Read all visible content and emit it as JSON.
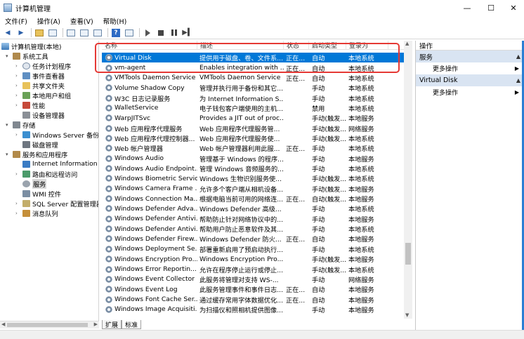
{
  "window": {
    "title": "计算机管理",
    "controls": {
      "minimize": "—",
      "maximize": "☐",
      "close": "✕"
    }
  },
  "menu": [
    "文件(F)",
    "操作(A)",
    "查看(V)",
    "帮助(H)"
  ],
  "tree": {
    "items": [
      {
        "label": "计算机管理(本地)",
        "icon": "computer-icon",
        "expander": "",
        "level": 0
      },
      {
        "label": "系统工具",
        "icon": "tools-icon",
        "expander": "▾",
        "level": 1
      },
      {
        "label": "任务计划程序",
        "icon": "task-scheduler-icon",
        "expander": "›",
        "level": 2
      },
      {
        "label": "事件查看器",
        "icon": "event-viewer-icon",
        "expander": "›",
        "level": 2
      },
      {
        "label": "共享文件夹",
        "icon": "shared-folder-icon",
        "expander": "›",
        "level": 2
      },
      {
        "label": "本地用户和组",
        "icon": "users-icon",
        "expander": "›",
        "level": 2
      },
      {
        "label": "性能",
        "icon": "performance-icon",
        "expander": "›",
        "level": 2
      },
      {
        "label": "设备管理器",
        "icon": "device-manager-icon",
        "expander": "",
        "level": 2
      },
      {
        "label": "存储",
        "icon": "storage-icon",
        "expander": "▾",
        "level": 1
      },
      {
        "label": "Windows Server 备份",
        "icon": "backup-icon",
        "expander": "›",
        "level": 2
      },
      {
        "label": "磁盘管理",
        "icon": "disk-icon",
        "expander": "",
        "level": 2
      },
      {
        "label": "服务和应用程序",
        "icon": "services-apps-icon",
        "expander": "▾",
        "level": 1
      },
      {
        "label": "Internet Information S",
        "icon": "iis-icon",
        "expander": "",
        "level": 2
      },
      {
        "label": "路由和远程访问",
        "icon": "routing-icon",
        "expander": "›",
        "level": 2
      },
      {
        "label": "服务",
        "icon": "services-gear-icon",
        "expander": "",
        "level": 2,
        "selected": true
      },
      {
        "label": "WMI 控件",
        "icon": "wmi-icon",
        "expander": "",
        "level": 2
      },
      {
        "label": "SQL Server 配置管理器",
        "icon": "sql-icon",
        "expander": "›",
        "level": 2
      },
      {
        "label": "消息队列",
        "icon": "message-queue-icon",
        "expander": "›",
        "level": 2
      }
    ]
  },
  "list": {
    "headers": [
      "名称",
      "描述",
      "状态",
      "启动类型",
      "登录为"
    ],
    "rows": [
      {
        "name": "Virtual Disk",
        "desc": "提供用于磁盘、卷、文件系...",
        "status": "正在...",
        "start": "自动",
        "logon": "本地系统",
        "selected": true
      },
      {
        "name": "vm-agent",
        "desc": "Enables integration with ...",
        "status": "正在...",
        "start": "自动",
        "logon": "本地系统"
      },
      {
        "name": "VMTools Daemon Service",
        "desc": "VMTools Daemon Service",
        "status": "正在...",
        "start": "自动",
        "logon": "本地系统"
      },
      {
        "name": "Volume Shadow Copy",
        "desc": "管理并执行用于备份和其它...",
        "status": "",
        "start": "手动",
        "logon": "本地系统"
      },
      {
        "name": "W3C 日志记录服务",
        "desc": "为 Internet Information S...",
        "status": "",
        "start": "手动",
        "logon": "本地系统"
      },
      {
        "name": "WalletService",
        "desc": "电子钱包客户端使用的主机...",
        "status": "",
        "start": "禁用",
        "logon": "本地系统"
      },
      {
        "name": "WarpJITSvc",
        "desc": "Provides a JIT out of proc...",
        "status": "",
        "start": "手动(触发...",
        "logon": "本地服务"
      },
      {
        "name": "Web 应用程序代理服务",
        "desc": "Web 应用程序代理服务管...",
        "status": "",
        "start": "手动(触发...",
        "logon": "网络服务"
      },
      {
        "name": "Web 应用程序代理控制器...",
        "desc": "Web 应用程序代理服务使...",
        "status": "",
        "start": "手动(触发...",
        "logon": "本地系统"
      },
      {
        "name": "Web 帐户管理器",
        "desc": "Web 帐户管理器利用此服...",
        "status": "正在...",
        "start": "手动",
        "logon": "本地系统"
      },
      {
        "name": "Windows Audio",
        "desc": "管理基于 Windows 的程序...",
        "status": "",
        "start": "手动",
        "logon": "本地服务"
      },
      {
        "name": "Windows Audio Endpoint...",
        "desc": "管理 Windows 音频服务的...",
        "status": "",
        "start": "手动",
        "logon": "本地系统"
      },
      {
        "name": "Windows Biometric Servic...",
        "desc": "Windows 生物识别服务使...",
        "status": "",
        "start": "手动(触发...",
        "logon": "本地系统"
      },
      {
        "name": "Windows Camera Frame ...",
        "desc": "允许多个客户端从相机设备...",
        "status": "",
        "start": "手动(触发...",
        "logon": "本地服务"
      },
      {
        "name": "Windows Connection Ma...",
        "desc": "根据电脑当前可用的网络连...",
        "status": "正在...",
        "start": "自动(触发...",
        "logon": "本地服务"
      },
      {
        "name": "Windows Defender Adva...",
        "desc": "Windows Defender 高级...",
        "status": "",
        "start": "手动",
        "logon": "本地系统"
      },
      {
        "name": "Windows Defender Antivi...",
        "desc": "帮助防止针对网络协议中的...",
        "status": "",
        "start": "手动",
        "logon": "本地服务"
      },
      {
        "name": "Windows Defender Antivi...",
        "desc": "帮助用户防止恶意软件及其...",
        "status": "",
        "start": "手动",
        "logon": "本地系统"
      },
      {
        "name": "Windows Defender Firew...",
        "desc": "Windows Defender 防火...",
        "status": "正在...",
        "start": "自动",
        "logon": "本地服务"
      },
      {
        "name": "Windows Deployment Se...",
        "desc": "部署重新启用了预启动执行...",
        "status": "",
        "start": "手动",
        "logon": "本地系统"
      },
      {
        "name": "Windows Encryption Pro...",
        "desc": "Windows Encryption Pro...",
        "status": "",
        "start": "手动(触发...",
        "logon": "本地服务"
      },
      {
        "name": "Windows Error Reportin...",
        "desc": "允许在程序停止运行或停止...",
        "status": "",
        "start": "手动(触发...",
        "logon": "本地系统"
      },
      {
        "name": "Windows Event Collector",
        "desc": "此服务将管理对支持 WS-...",
        "status": "",
        "start": "手动",
        "logon": "网络服务"
      },
      {
        "name": "Windows Event Log",
        "desc": "此服务管理事件和事件日志...",
        "status": "正在...",
        "start": "自动",
        "logon": "本地服务"
      },
      {
        "name": "Windows Font Cache Ser...",
        "desc": "通过缓存常用字体数据优化...",
        "status": "正在...",
        "start": "自动",
        "logon": "本地服务"
      },
      {
        "name": "Windows Image Acquisiti...",
        "desc": "为扫描仪和照相机提供图像...",
        "status": "",
        "start": "手动",
        "logon": "本地服务"
      }
    ]
  },
  "tabs": [
    "扩展",
    "标准"
  ],
  "actions": {
    "header": "操作",
    "sections": [
      {
        "title": "服务",
        "item": "更多操作"
      },
      {
        "title": "Virtual Disk",
        "item": "更多操作"
      }
    ]
  }
}
